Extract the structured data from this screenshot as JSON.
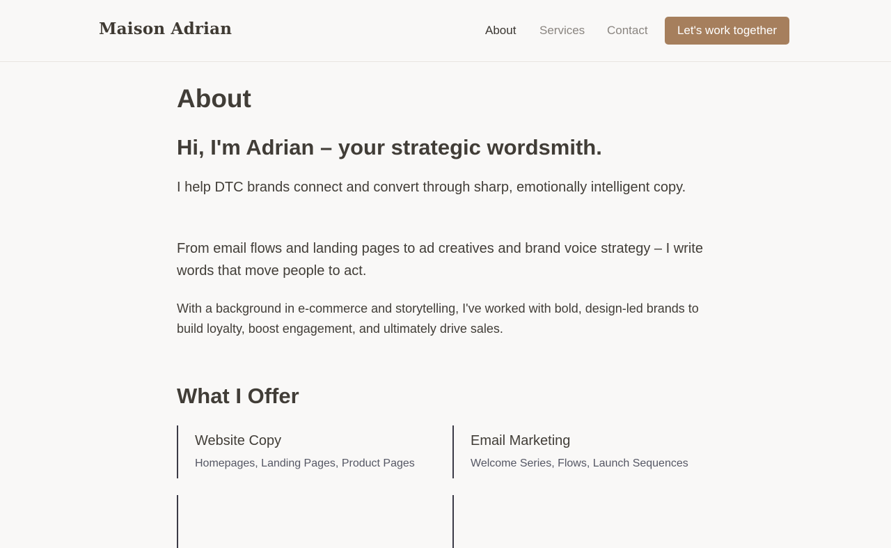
{
  "header": {
    "brand": "Maison Adrian",
    "nav": [
      {
        "label": "About"
      },
      {
        "label": "Services"
      },
      {
        "label": "Contact"
      }
    ],
    "cta_label": "Let's work together"
  },
  "about": {
    "title": "About",
    "headline": "Hi, I'm Adrian – your strategic wordsmith.",
    "paragraphs": [
      "I help DTC brands connect and convert through sharp, emotionally intelligent copy.",
      "From email flows and landing pages to ad creatives and brand voice strategy – I write words that move people to act.",
      "With a background in e-commerce and storytelling, I've worked with bold, design-led brands to build loyalty, boost engagement, and ultimately drive sales."
    ]
  },
  "offer": {
    "title": "What I Offer",
    "items": [
      {
        "title": "Website Copy",
        "description": "Homepages, Landing Pages, Product Pages"
      },
      {
        "title": "Email Marketing",
        "description": "Welcome Series, Flows, Launch Sequences"
      },
      {
        "title": "",
        "description": ""
      },
      {
        "title": "",
        "description": ""
      }
    ]
  },
  "colors": {
    "background": "#f9f8f7",
    "accent": "#a67f5d",
    "text": "#413d37",
    "muted": "#8a8580",
    "card_border": "#3b3a46"
  }
}
